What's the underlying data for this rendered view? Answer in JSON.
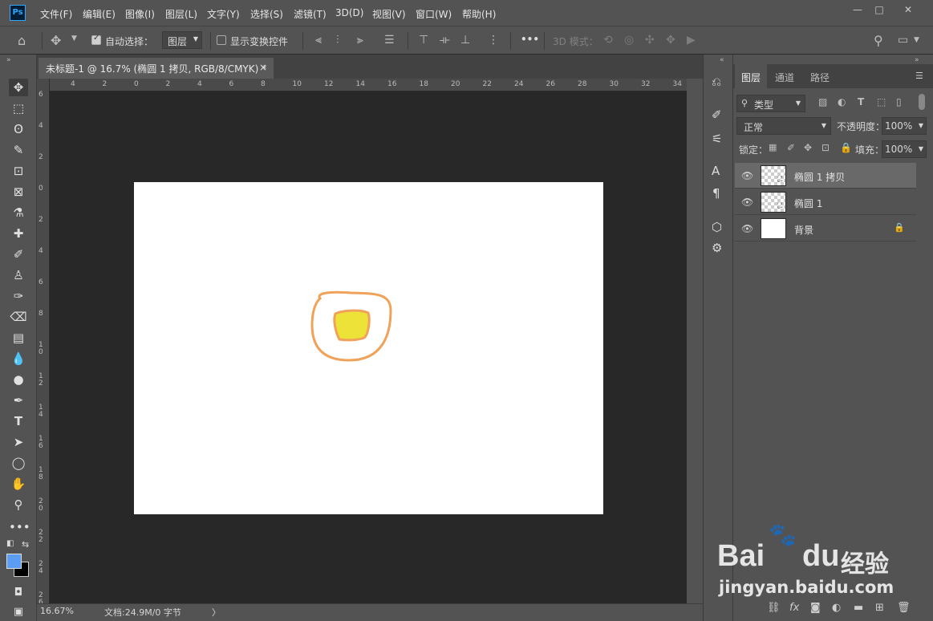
{
  "menubar": {
    "logo": "Ps",
    "items": [
      "文件(F)",
      "编辑(E)",
      "图像(I)",
      "图层(L)",
      "文字(Y)",
      "选择(S)",
      "滤镜(T)",
      "3D(D)",
      "视图(V)",
      "窗口(W)",
      "帮助(H)"
    ]
  },
  "window_controls": {
    "minimize": "—",
    "maximize": "□",
    "close": "✕"
  },
  "options": {
    "auto_select_label": "自动选择：",
    "auto_select_checked": true,
    "auto_select_target": "图层",
    "show_transform_label": "显示变换控件",
    "show_transform_checked": false,
    "more": "•••",
    "mode3d_label": "3D 模式："
  },
  "document": {
    "tab_title": "未标题-1 @ 16.7% (椭圆 1 拷贝, RGB/8/CMYK) *",
    "tab_close": "×"
  },
  "ruler": {
    "horizontal": [
      "4",
      "2",
      "0",
      "2",
      "4",
      "6",
      "8",
      "10",
      "12",
      "14",
      "16",
      "18",
      "20",
      "22",
      "24",
      "26",
      "28",
      "30",
      "32",
      "34"
    ],
    "vertical": [
      "6",
      "4",
      "2",
      "0",
      "2",
      "4",
      "6",
      "8",
      "1 0",
      "1 2",
      "1 4",
      "1 6",
      "1 8",
      "2 0",
      "2 2",
      "2 4",
      "2 6"
    ]
  },
  "status": {
    "zoom": "16.67%",
    "doc_info": "文档:24.9M/0 字节",
    "arrow": "〉"
  },
  "colors": {
    "foreground": "#5b9cf5",
    "background": "#000000",
    "shape_outer_stroke": "#f0a25a",
    "shape_inner_stroke": "#f0a25a",
    "shape_inner_fill": "#ece238"
  },
  "layers_panel": {
    "tabs": [
      "图层",
      "通道",
      "路径"
    ],
    "active_tab": "图层",
    "filter_label": "类型",
    "blend_mode": "正常",
    "opacity_label": "不透明度：",
    "opacity_value": "100%",
    "lock_label": "锁定：",
    "fill_label": "填充：",
    "fill_value": "100%",
    "layers": [
      {
        "name": "椭圆 1 拷贝",
        "selected": true,
        "locked": false
      },
      {
        "name": "椭圆 1",
        "selected": false,
        "locked": false
      },
      {
        "name": "背景",
        "selected": false,
        "locked": true
      }
    ]
  },
  "watermark": {
    "brand": "Bai",
    "brand_suffix": "du",
    "cn": "经验",
    "url": "jingyan.baidu.com"
  }
}
